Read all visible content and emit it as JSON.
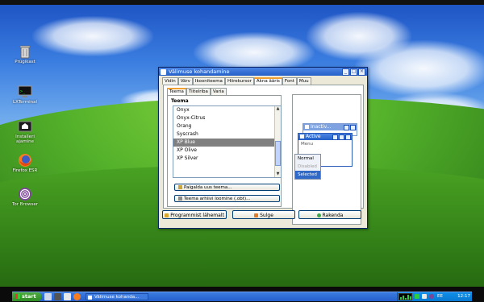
{
  "desktop": {
    "icons": [
      {
        "label": "Prügikast",
        "icon": "trash-icon"
      },
      {
        "label": "LXTerminal",
        "icon": "terminal-icon"
      },
      {
        "label": "Installeri ajamine",
        "icon": "installer-icon"
      },
      {
        "label": "Firefox ESR",
        "icon": "firefox-icon"
      },
      {
        "label": "Tor Browser",
        "icon": "tor-browser-icon"
      }
    ]
  },
  "window": {
    "title": "Välimuse kohandamine",
    "tabs": [
      "Vidin",
      "Värv",
      "Ikooniteema",
      "Hiirekursor",
      "Akna ääris",
      "Font",
      "Muu"
    ],
    "active_tab": "Akna ääris",
    "subtabs": [
      "Teema",
      "Tiitelriba",
      "Varia"
    ],
    "active_subtab": "Teema",
    "section_title": "Teema",
    "themes": [
      "Onyx",
      "Onyx-Citrus",
      "Orang",
      "Syscrash",
      "XP Blue",
      "XP Olive",
      "XP Silver"
    ],
    "selected_theme": "XP Blue",
    "add_theme_label": "Paigalda uus teema...",
    "archive_theme_label": "Teema arhiivi loomine (.obt)...",
    "preview": {
      "inactive_title": "Inactiv...",
      "active_title": "Active",
      "menu_label": "Menu",
      "menu_items": [
        {
          "label": "Normal",
          "state": "normal"
        },
        {
          "label": "Disabled",
          "state": "disabled"
        },
        {
          "label": "Selected",
          "state": "selected"
        }
      ]
    },
    "buttons": {
      "about": "Programmist lähemalt",
      "close": "Sulge",
      "apply": "Rakenda"
    }
  },
  "taskbar": {
    "start_label": "start",
    "task_label": "Välimuse kohanda...",
    "keyboard_layout": "EE",
    "clock": "12:17"
  },
  "colors": {
    "titlebar": "#2460c8",
    "taskbar": "#245ecc",
    "start_button": "#2f8a24",
    "selected_item": "#808080",
    "tray": "#0a78d0"
  }
}
